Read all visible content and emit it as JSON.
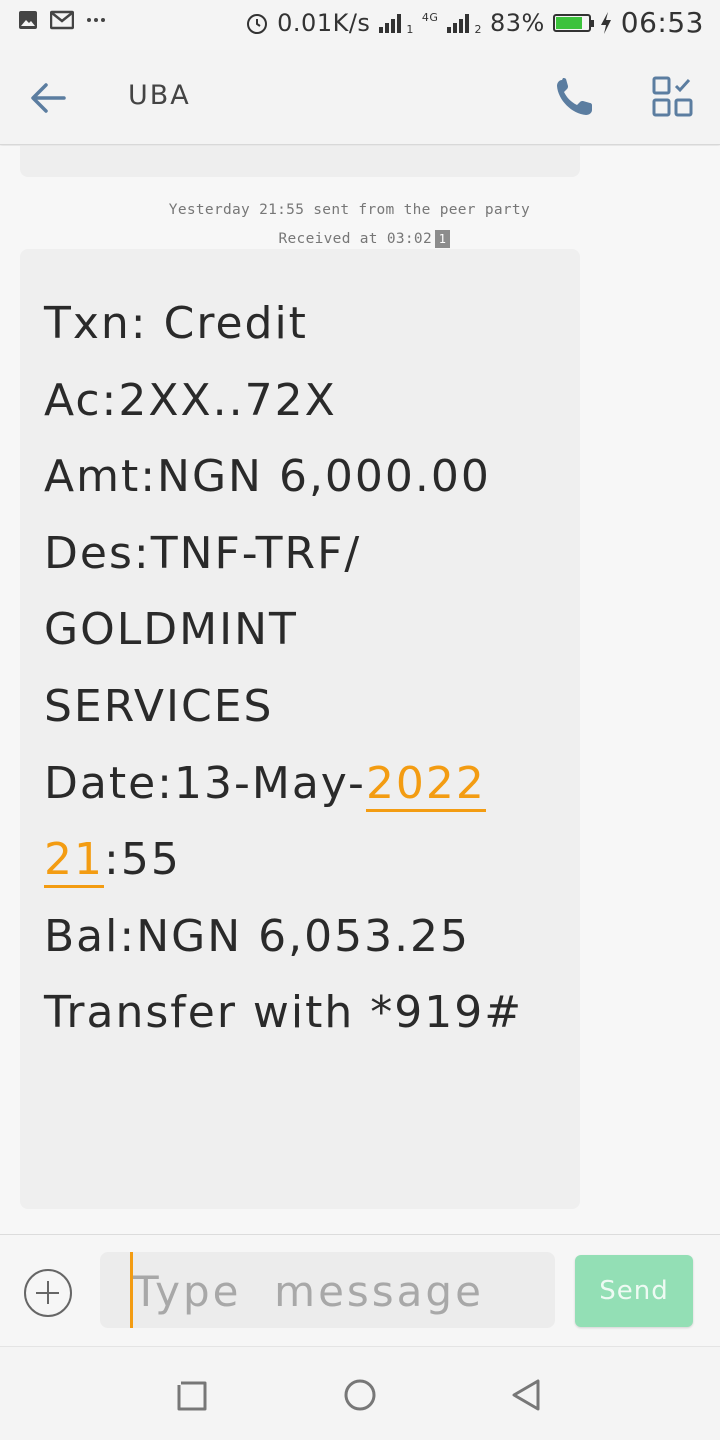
{
  "status_bar": {
    "network_speed": "0.01K/s",
    "sim1_label": "1",
    "network_type": "4G",
    "sim2_label": "2",
    "battery_percent": "83%",
    "battery_level": 0.83,
    "time": "06:53",
    "icons": [
      "gallery-icon",
      "gmail-icon",
      "more-notifications-icon",
      "alarm-icon",
      "signal-icon",
      "battery-icon",
      "charging-icon"
    ]
  },
  "header": {
    "title": "UBA",
    "icons": [
      "back-arrow-icon",
      "phone-icon",
      "grid-icon"
    ]
  },
  "conversation": {
    "sent_info": "Yesterday 21:55 sent from the peer party",
    "received_info": "Received at 03:02",
    "sim_badge": "1",
    "message": {
      "line1": "Txn:  Credit",
      "line2": "Ac:2XX..72X",
      "line3": "Amt:NGN  6,000.00",
      "line4": "Des:TNF-TRF/",
      "line5": "GOLDMINT",
      "line6": "SERVICES",
      "line7_prefix": "Date:13-May-",
      "line7_link": "2022",
      "line8_link": "21",
      "line8_suffix": ":55",
      "line9": "Bal:NGN  6,053.25",
      "line10": "Transfer  with  *919#"
    },
    "link_color": "#f39c12"
  },
  "composer": {
    "placeholder": "Type  message",
    "value": "",
    "send_label": "Send",
    "send_color": "#93dfb5",
    "icons": [
      "plus-icon"
    ]
  },
  "navigation": {
    "icons": [
      "recents-icon",
      "home-icon",
      "back-icon"
    ]
  }
}
